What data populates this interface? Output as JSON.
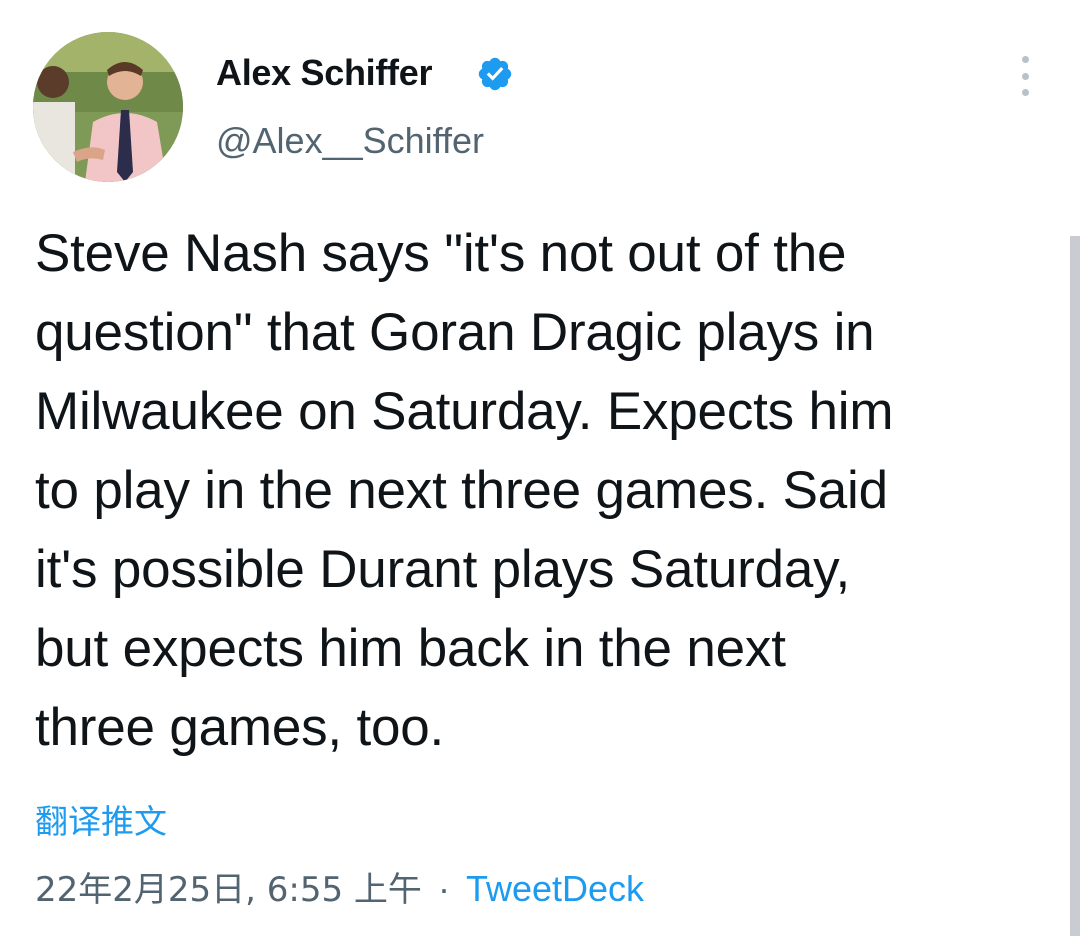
{
  "author": {
    "name": "Alex Schiffer",
    "handle": "@Alex__Schiffer",
    "verified": true,
    "avatar_icon": "profile-photo"
  },
  "menu_icon": "more-vertical-icon",
  "tweet": {
    "text": "Steve Nash says \"it's not out of the\nquestion\" that Goran Dragic plays in\nMilwaukee on Saturday. Expects him\nto play in the next three games. Said\nit's possible Durant plays Saturday,\nbut expects him back in the next\nthree games, too."
  },
  "translate_label": "翻译推文",
  "meta": {
    "timestamp": "22年2月25日, 6:55 上午",
    "separator": "·",
    "source": "TweetDeck"
  },
  "colors": {
    "accent": "#1d9bf0",
    "text": "#0f1419",
    "secondary": "#536471"
  }
}
